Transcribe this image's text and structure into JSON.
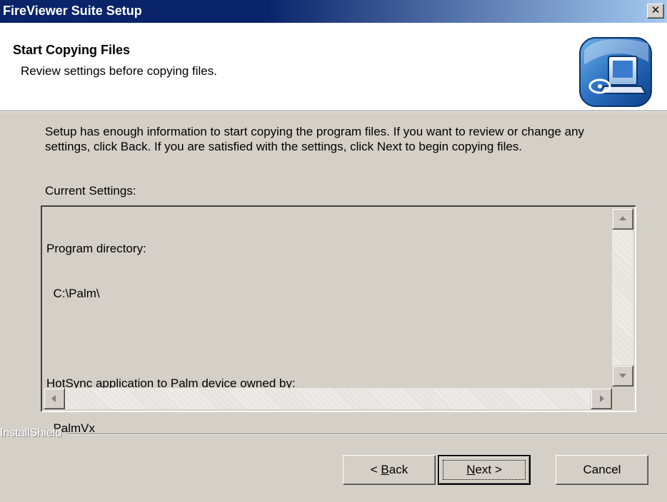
{
  "window": {
    "title": "FireViewer Suite Setup",
    "close_glyph": "✕"
  },
  "header": {
    "title": "Start Copying Files",
    "subtitle": "Review settings before copying files.",
    "icon": "setup-computer-icon"
  },
  "body": {
    "intro": "Setup has enough information to start copying the program files.  If you want to review or change any settings, click Back.  If you are satisfied with the settings, click Next to begin copying files.",
    "current_settings_label": "Current Settings:",
    "settings_lines": [
      "Program directory:",
      "  C:\\Palm\\",
      "",
      "HotSync application to Palm device owned by:",
      "  PalmVx"
    ]
  },
  "footer": {
    "brand": "InstallShield",
    "back": {
      "prefix": "< ",
      "mnemonic": "B",
      "rest": "ack"
    },
    "next": {
      "mnemonic": "N",
      "rest": "ext >"
    },
    "cancel": "Cancel"
  },
  "colors": {
    "title_bar": "#0a246a",
    "dialog_face": "#d4d0c8",
    "header_bg": "#ffffff"
  }
}
